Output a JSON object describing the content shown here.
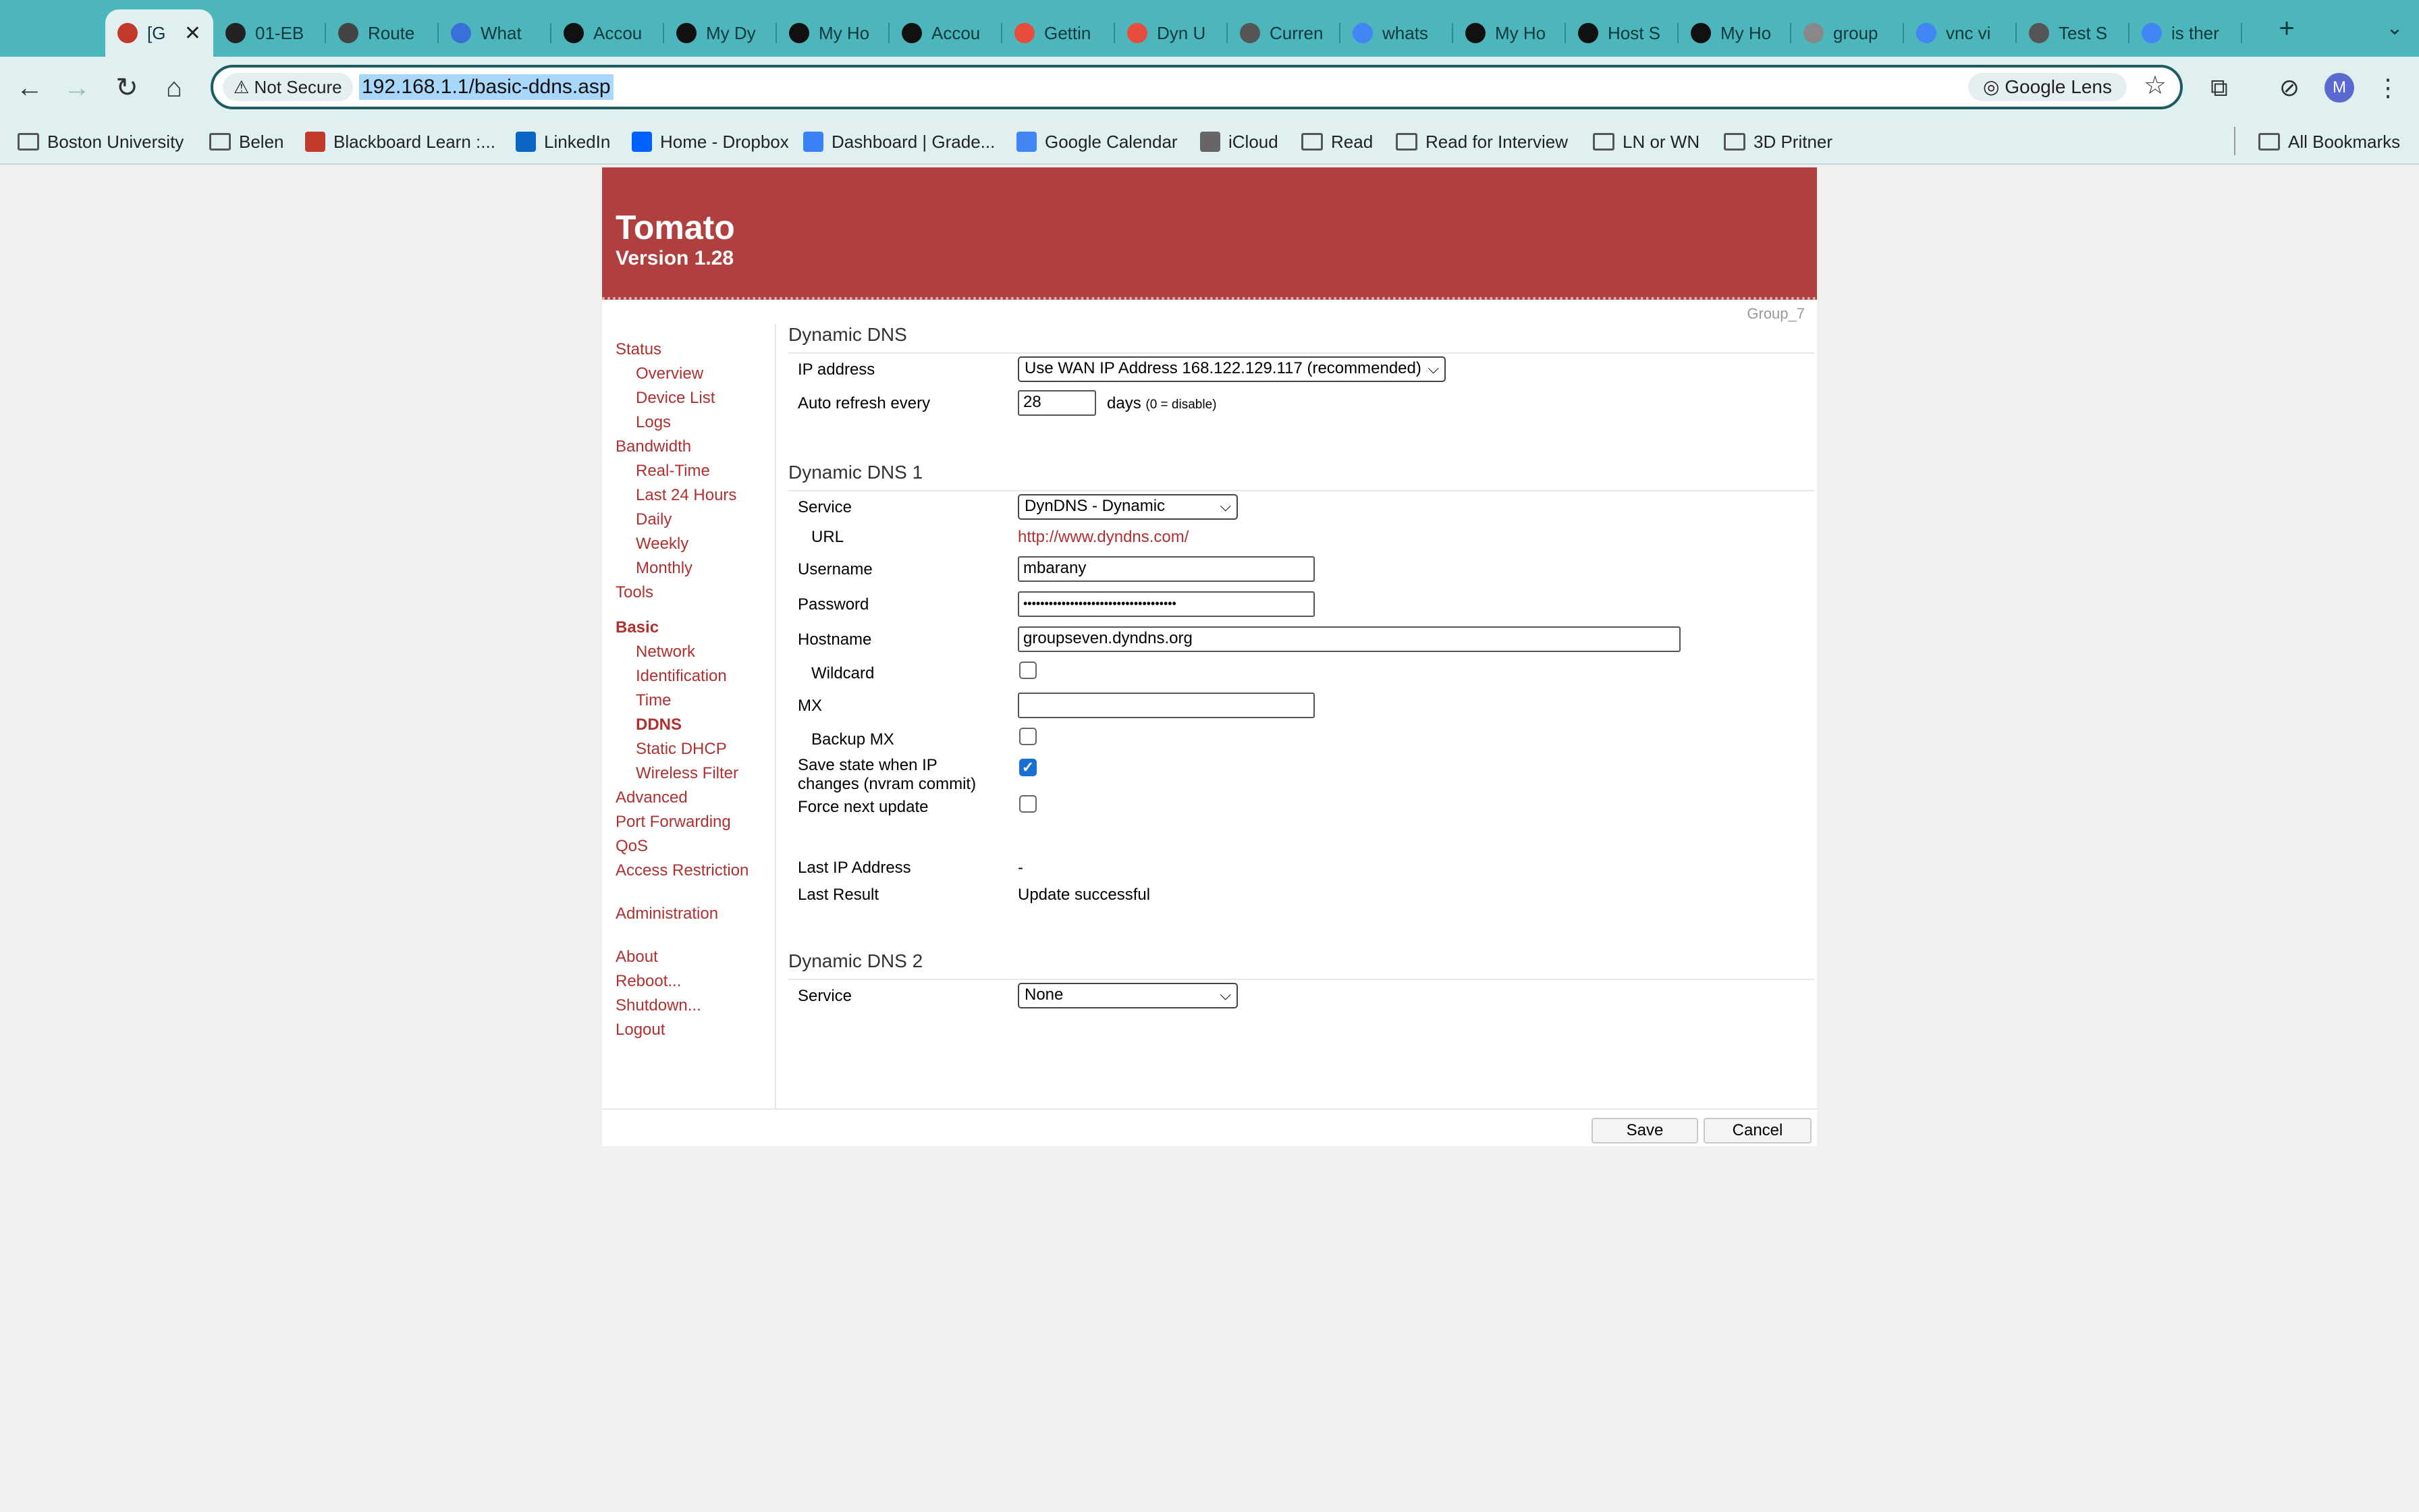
{
  "browser": {
    "tabs": [
      {
        "label": "[G",
        "color": "#c0392b",
        "active": true
      },
      {
        "label": "01-EB",
        "color": "#222222"
      },
      {
        "label": "Route",
        "color": "#444444"
      },
      {
        "label": "What",
        "color": "#3b6fd8"
      },
      {
        "label": "Accou",
        "color": "#111111"
      },
      {
        "label": "My Dy",
        "color": "#111111"
      },
      {
        "label": "My Ho",
        "color": "#111111"
      },
      {
        "label": "Accou",
        "color": "#111111"
      },
      {
        "label": "Gettin",
        "color": "#e74c3c"
      },
      {
        "label": "Dyn U",
        "color": "#e74c3c"
      },
      {
        "label": "Curren",
        "color": "#555555"
      },
      {
        "label": "whats",
        "color": "#4285f4"
      },
      {
        "label": "My Ho",
        "color": "#111111"
      },
      {
        "label": "Host S",
        "color": "#111111"
      },
      {
        "label": "My Ho",
        "color": "#111111"
      },
      {
        "label": "group",
        "color": "#888888"
      },
      {
        "label": "vnc vi",
        "color": "#4285f4"
      },
      {
        "label": "Test S",
        "color": "#555555"
      },
      {
        "label": "is ther",
        "color": "#4285f4"
      }
    ],
    "security_label": "Not Secure",
    "url": "192.168.1.1/basic-ddns.asp",
    "lens_label": "Google Lens",
    "avatar_letter": "M",
    "bookmarks": [
      "Boston University",
      "Belen",
      "Blackboard Learn :...",
      "LinkedIn",
      "Home - Dropbox",
      "Dashboard | Grade...",
      "Google Calendar",
      "iCloud",
      "Read",
      "Read for Interview",
      "LN or WN",
      "3D Pritner"
    ],
    "all_bookmarks": "All Bookmarks"
  },
  "router": {
    "title": "Tomato",
    "version": "Version 1.28",
    "group_tag": "Group_7",
    "nav": [
      {
        "label": "Status",
        "level": 0
      },
      {
        "label": "Overview",
        "level": 1
      },
      {
        "label": "Device List",
        "level": 1
      },
      {
        "label": "Logs",
        "level": 1
      },
      {
        "label": "Bandwidth",
        "level": 0
      },
      {
        "label": "Real-Time",
        "level": 1
      },
      {
        "label": "Last 24 Hours",
        "level": 1
      },
      {
        "label": "Daily",
        "level": 1
      },
      {
        "label": "Weekly",
        "level": 1
      },
      {
        "label": "Monthly",
        "level": 1
      },
      {
        "label": "Tools",
        "level": 0
      },
      {
        "label": "Basic",
        "level": 0,
        "current": true
      },
      {
        "label": "Network",
        "level": 1
      },
      {
        "label": "Identification",
        "level": 1
      },
      {
        "label": "Time",
        "level": 1
      },
      {
        "label": "DDNS",
        "level": 1,
        "current": true
      },
      {
        "label": "Static DHCP",
        "level": 1
      },
      {
        "label": "Wireless Filter",
        "level": 1
      },
      {
        "label": "Advanced",
        "level": 0
      },
      {
        "label": "Port Forwarding",
        "level": 0
      },
      {
        "label": "QoS",
        "level": 0
      },
      {
        "label": "Access Restriction",
        "level": 0
      },
      {
        "label": "Administration",
        "level": 0
      },
      {
        "label": "About",
        "level": 0
      },
      {
        "label": "Reboot...",
        "level": 0
      },
      {
        "label": "Shutdown...",
        "level": 0
      },
      {
        "label": "Logout",
        "level": 0
      }
    ],
    "ddns": {
      "heading": "Dynamic DNS",
      "ip_label": "IP address",
      "ip_value": "Use WAN IP Address 168.122.129.117 (recommended)",
      "refresh_label": "Auto refresh every",
      "refresh_value": "28",
      "refresh_unit": "days",
      "refresh_hint": "(0 = disable)"
    },
    "ddns1": {
      "heading": "Dynamic DNS 1",
      "service_label": "Service",
      "service_value": "DynDNS - Dynamic",
      "url_label": "URL",
      "url_value": "http://www.dyndns.com/",
      "username_label": "Username",
      "username_value": "mbarany",
      "password_label": "Password",
      "password_value": "••••••••••••••••••••••••••••••••••••",
      "hostname_label": "Hostname",
      "hostname_value": "groupseven.dyndns.org",
      "wildcard_label": "Wildcard",
      "wildcard_checked": false,
      "mx_label": "MX",
      "mx_value": "",
      "backup_mx_label": "Backup MX",
      "backup_mx_checked": false,
      "save_state_label_1": "Save state when IP",
      "save_state_label_2": "changes (nvram commit)",
      "save_state_checked": true,
      "force_label": "Force next update",
      "force_checked": false,
      "last_ip_label": "Last IP Address",
      "last_ip_value": "-",
      "last_result_label": "Last Result",
      "last_result_value": "Update successful"
    },
    "ddns2": {
      "heading": "Dynamic DNS 2",
      "service_label": "Service",
      "service_value": "None"
    },
    "buttons": {
      "save": "Save",
      "cancel": "Cancel"
    },
    "colors": {
      "brand": "#b04040",
      "link": "#b03030",
      "browser_accent": "#4db6bd"
    }
  }
}
